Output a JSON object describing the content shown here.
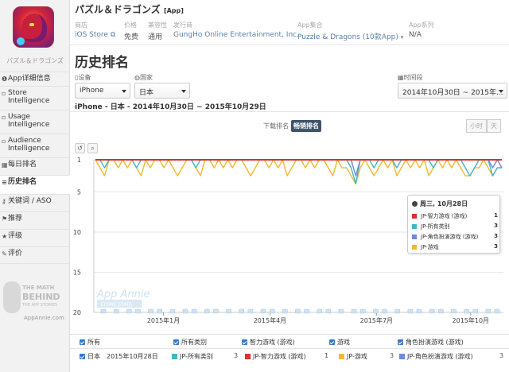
{
  "sidebar": {
    "app_name": "パズル＆ドラゴンズ",
    "items": [
      {
        "icon": "info-icon",
        "label": "App详细信息"
      },
      {
        "icon": "store-icon",
        "label": "Store Intelligence"
      },
      {
        "icon": "usage-icon",
        "label": "Usage Intelligence"
      },
      {
        "icon": "audience-icon",
        "label": "Audience Intelligence"
      },
      {
        "icon": "calendar-icon",
        "label": "每日排名"
      },
      {
        "icon": "list-icon",
        "label": "历史排名"
      },
      {
        "icon": "key-icon",
        "label": "关键词 / ASO"
      },
      {
        "icon": "recommend-icon",
        "label": "推荐"
      },
      {
        "icon": "star-icon",
        "label": "评级"
      },
      {
        "icon": "comment-icon",
        "label": "评价"
      }
    ],
    "logo": {
      "line1": "THE MATH",
      "line2": "BEHIND",
      "line3": "THE APP STORIES",
      "url": "AppAnnie.com"
    }
  },
  "header": {
    "title": "パズル＆ドラゴンズ",
    "title_tag": "[App]",
    "meta": [
      {
        "label": "商店",
        "value": "iOS Store"
      },
      {
        "label": "价格",
        "value": "免费"
      },
      {
        "label": "兼容性",
        "value": "通用"
      },
      {
        "label": "发行商",
        "value": "GungHo Online Entertainment, Inc."
      },
      {
        "label": "App集合",
        "value": "Puzzle & Dragons (10款App)"
      },
      {
        "label": "App系列",
        "value": "N/A"
      }
    ]
  },
  "page_title": "历史排名",
  "filters": {
    "device": {
      "label": "设备",
      "value": "iPhone"
    },
    "country": {
      "label": "国家",
      "value": "日本"
    },
    "time": {
      "label": "时间段",
      "value": "2014年10月30日 ~ 2015年..."
    }
  },
  "summary": "iPhone - 日本 - 2014年10月30日 ~ 2015年10月29日",
  "toggle": {
    "downloads": "下载排名",
    "grossing": "畅销排名"
  },
  "granularity": [
    "小时",
    "天"
  ],
  "chart_toolbar": {
    "reset": "↺",
    "zoom": "🔍"
  },
  "tooltip": {
    "date": "周三, 10月28日",
    "rows": [
      {
        "label": "JP-智力游戏 (游戏)",
        "rank": "1",
        "color": "#d9332c"
      },
      {
        "label": "JP-所有类别",
        "rank": "3",
        "color": "#45b5c2"
      },
      {
        "label": "JP-角色扮演游戏 (游戏)",
        "rank": "3",
        "color": "#6b8be0"
      },
      {
        "label": "JP-游戏",
        "rank": "3",
        "color": "#f5b731"
      }
    ]
  },
  "watermark": {
    "line1": "App Annie",
    "line2": "STORE STATS"
  },
  "chart_data": {
    "type": "line",
    "ylim": [
      1,
      20
    ],
    "y_ticks": [
      "1",
      "5",
      "10",
      "15",
      "20"
    ],
    "x_ticks": [
      "2015年1月",
      "2015年4月",
      "2015年7月",
      "2015年10月"
    ],
    "series": [
      {
        "name": "JP-智力游戏 (游戏)",
        "color": "#d9332c",
        "values": [
          1,
          1,
          1,
          1,
          1,
          1,
          1,
          1,
          1,
          1,
          1,
          1,
          1,
          1,
          1,
          1,
          1,
          1,
          1,
          1,
          1,
          1,
          1,
          1,
          1,
          1,
          1,
          1,
          1,
          1,
          1,
          1,
          1,
          1,
          1,
          1,
          1,
          1,
          1,
          1,
          1,
          1,
          1,
          1,
          1,
          1,
          1,
          1,
          1,
          1,
          1,
          1,
          1,
          1,
          1,
          1,
          1,
          1,
          1,
          1,
          1,
          1,
          1,
          1,
          1,
          1,
          1,
          1,
          1,
          1,
          1,
          1,
          1,
          1,
          1,
          1,
          1,
          1,
          1,
          1,
          1,
          1,
          1,
          1,
          1,
          1,
          1,
          1,
          1,
          1
        ]
      },
      {
        "name": "JP-所有类别",
        "color": "#45b5c2",
        "values": [
          1,
          1,
          2,
          1,
          1,
          1,
          1,
          1,
          1,
          2,
          1,
          1,
          1,
          1,
          1,
          1,
          1,
          1,
          1,
          1,
          1,
          1,
          2,
          1,
          1,
          1,
          1,
          1,
          1,
          1,
          1,
          1,
          1,
          1,
          1,
          1,
          1,
          1,
          1,
          1,
          1,
          1,
          1,
          1,
          1,
          1,
          1,
          1,
          1,
          1,
          1,
          1,
          1,
          1,
          1,
          1,
          2,
          4,
          1,
          1,
          1,
          2,
          1,
          1,
          1,
          1,
          2,
          1,
          1,
          1,
          1,
          1,
          1,
          1,
          2,
          1,
          1,
          1,
          1,
          1,
          1,
          2,
          3,
          2,
          1,
          1,
          1,
          3,
          2,
          2
        ]
      },
      {
        "name": "JP-角色扮演游戏 (游戏)",
        "color": "#6b8be0",
        "values": [
          1,
          1,
          1,
          1,
          1,
          1,
          1,
          1,
          1,
          1,
          1,
          1,
          1,
          1,
          1,
          1,
          1,
          1,
          1,
          1,
          1,
          1,
          1,
          1,
          1,
          1,
          1,
          1,
          1,
          1,
          1,
          1,
          1,
          1,
          1,
          1,
          1,
          1,
          1,
          1,
          1,
          1,
          1,
          1,
          1,
          1,
          1,
          1,
          1,
          1,
          1,
          1,
          1,
          1,
          1,
          1,
          1,
          3,
          1,
          1,
          1,
          1,
          1,
          1,
          1,
          1,
          1,
          1,
          1,
          1,
          1,
          1,
          1,
          1,
          1,
          1,
          1,
          1,
          1,
          1,
          1,
          1,
          1,
          1,
          1,
          1,
          1,
          2,
          1,
          2
        ]
      },
      {
        "name": "JP-游戏",
        "color": "#f5b731",
        "values": [
          1,
          2,
          3,
          1,
          1,
          2,
          1,
          2,
          1,
          2,
          3,
          1,
          2,
          1,
          1,
          2,
          1,
          2,
          3,
          2,
          1,
          1,
          2,
          3,
          1,
          1,
          2,
          1,
          2,
          1,
          2,
          1,
          1,
          2,
          3,
          2,
          1,
          1,
          2,
          1,
          2,
          1,
          3,
          2,
          1,
          1,
          2,
          1,
          2,
          1,
          1,
          2,
          3,
          1,
          2,
          2,
          3,
          4,
          2,
          1,
          2,
          3,
          2,
          1,
          2,
          1,
          3,
          2,
          1,
          2,
          1,
          2,
          1,
          3,
          2,
          1,
          2,
          1,
          2,
          1,
          2,
          3,
          3,
          2,
          2,
          1,
          2,
          3,
          2,
          2
        ]
      }
    ],
    "event_markers": 36
  },
  "legend": {
    "row1": {
      "all": "所有",
      "items": [
        "所有类别",
        "智力游戏 (游戏)",
        "游戏",
        "角色扮演游戏 (游戏)"
      ]
    },
    "row2": {
      "country": "日本",
      "date": "2015年10月28日",
      "items": [
        {
          "label": "JP-所有类别",
          "value": "3",
          "color": "#45b5c2"
        },
        {
          "label": "JP-智力游戏 (游戏)",
          "value": "1",
          "color": "#d9332c"
        },
        {
          "label": "JP-游戏",
          "value": "3",
          "color": "#f5b731"
        },
        {
          "label": "JP-角色扮演游戏 (游戏)",
          "value": "3",
          "color": "#6b8be0"
        }
      ]
    }
  }
}
